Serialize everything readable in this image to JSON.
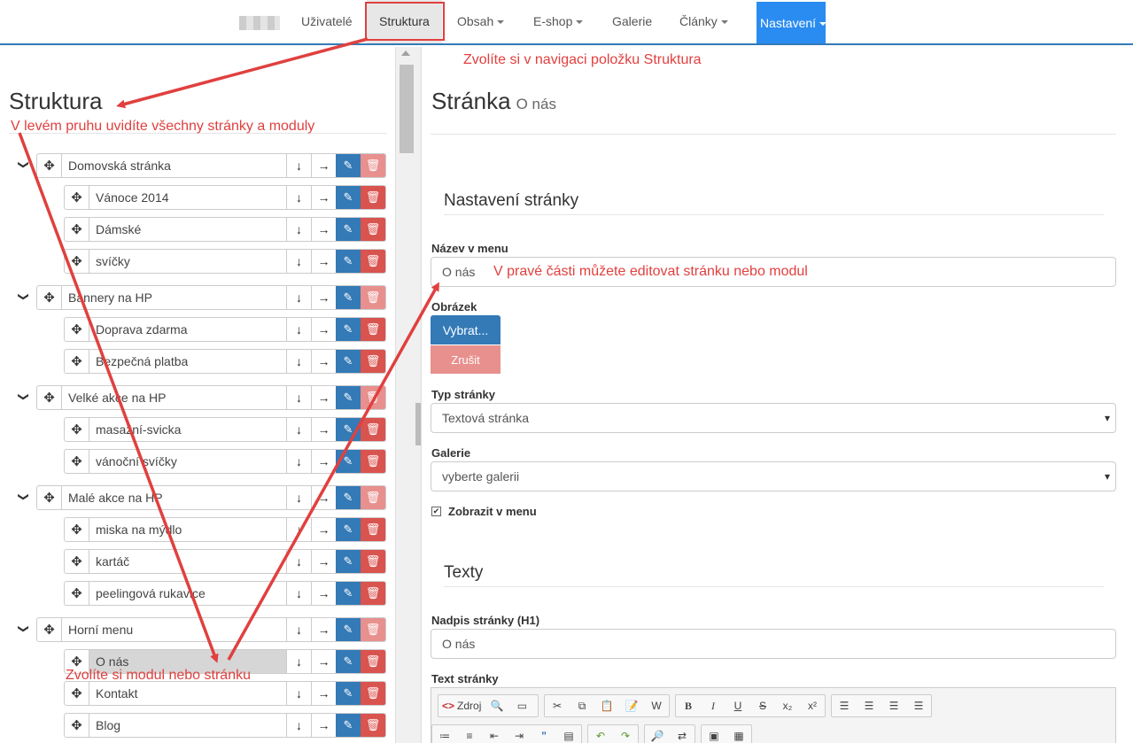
{
  "nav": {
    "items": [
      {
        "label": "Uživatelé"
      },
      {
        "label": "Struktura"
      },
      {
        "label": "Obsah"
      },
      {
        "label": "E-shop"
      },
      {
        "label": "Galerie"
      },
      {
        "label": "Články"
      },
      {
        "label": "Nastavení"
      }
    ],
    "active": "Struktura",
    "highlight": "Nastavení"
  },
  "left": {
    "title": "Struktura",
    "tree": [
      {
        "label": "Domovská stránka",
        "level": 0,
        "expanded": true
      },
      {
        "label": "Vánoce 2014",
        "level": 1
      },
      {
        "label": "Dámské",
        "level": 1
      },
      {
        "label": "svíčky",
        "level": 1
      },
      {
        "label": "Bannery na HP",
        "level": 0,
        "expanded": true
      },
      {
        "label": "Doprava zdarma",
        "level": 1
      },
      {
        "label": "Bezpečná platba",
        "level": 1
      },
      {
        "label": "Velké akce na HP",
        "level": 0,
        "expanded": true
      },
      {
        "label": "masažní-svicka",
        "level": 1
      },
      {
        "label": "vánoční svíčky",
        "level": 1
      },
      {
        "label": "Malé akce na HP",
        "level": 0,
        "expanded": true
      },
      {
        "label": "miska na mýdlo",
        "level": 1
      },
      {
        "label": "kartáč",
        "level": 1
      },
      {
        "label": "peelingová rukavice",
        "level": 1
      },
      {
        "label": "Horní menu",
        "level": 0,
        "expanded": true
      },
      {
        "label": "O nás",
        "level": 1,
        "selected": true
      },
      {
        "label": "Kontakt",
        "level": 1
      },
      {
        "label": "Blog",
        "level": 1
      }
    ]
  },
  "right": {
    "title": "Stránka",
    "subtitle": "O nás",
    "section_settings": "Nastavení stránky",
    "label_menu_name": "Název v menu",
    "menu_name_value": "O nás",
    "label_image": "Obrázek",
    "btn_choose": "Vybrat...",
    "btn_cancel": "Zrušit",
    "label_page_type": "Typ stránky",
    "page_type_value": "Textová stránka",
    "label_gallery": "Galerie",
    "gallery_value": "vyberte galerii",
    "show_in_menu": "Zobrazit v menu",
    "show_in_menu_checked": true,
    "section_texts": "Texty",
    "label_h1": "Nadpis stránky (H1)",
    "h1_value": "O nás",
    "label_text": "Text stránky",
    "editor_source": "Zdroj"
  },
  "annotations": {
    "nav_hint": "Zvolíte si v navigaci položku Struktura",
    "left_hint": "V levém pruhu uvidíte všechny stránky a moduly",
    "right_hint": "V pravé části můžete editovat stránku nebo modul",
    "pick_hint": "Zvolíte si modul nebo stránku",
    "color": "#e0403f"
  },
  "colors": {
    "primary": "#337ab7",
    "danger": "#d9534f",
    "danger_faded": "#e8908e",
    "nav_highlight": "#2a8cf0"
  }
}
